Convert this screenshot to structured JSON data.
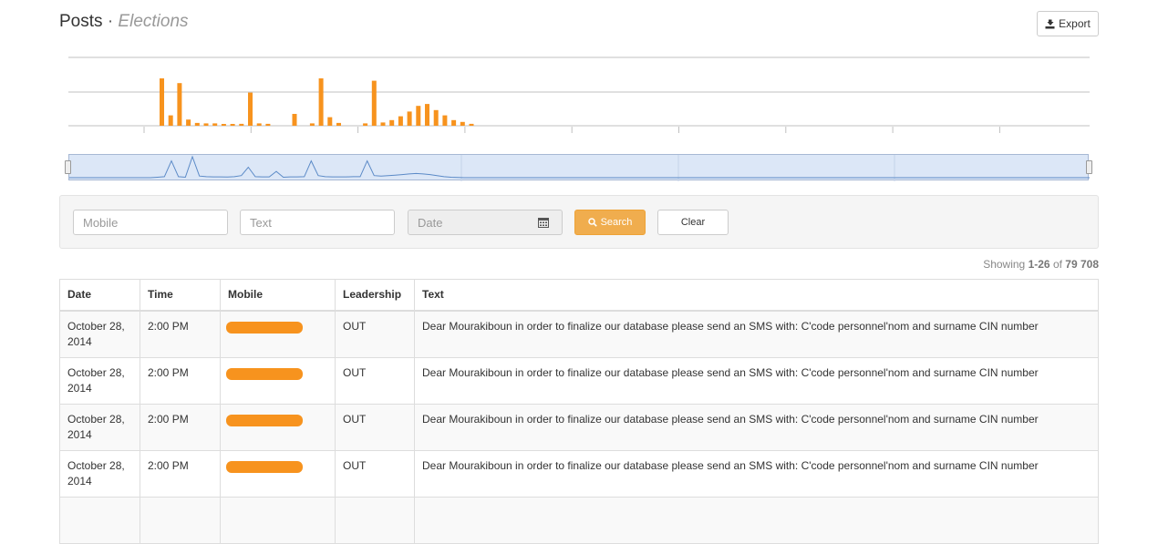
{
  "header": {
    "title": "Posts",
    "separator": "·",
    "subtitle": "Elections",
    "export_label": "Export"
  },
  "colors": {
    "bar": "#f7931e",
    "search_button": "#f0ad4e",
    "navigator_fill": "#dce7f7",
    "navigator_line": "#5b8ac7"
  },
  "chart_data": {
    "type": "bar",
    "series": [
      {
        "values": [
          1.0,
          0.22,
          0.9,
          0.13,
          0.06,
          0.05,
          0.05,
          0.02,
          0.02,
          0.04,
          0.7,
          0.05,
          0.04,
          0.0,
          0.0,
          0.25,
          0.0,
          0.05,
          1.0,
          0.18,
          0.06,
          0.0,
          0.0,
          0.05,
          0.95,
          0.07,
          0.12,
          0.2,
          0.3,
          0.42,
          0.46,
          0.33,
          0.22,
          0.12,
          0.08,
          0.04
        ]
      }
    ],
    "grid": true
  },
  "navigator": {
    "series": [
      0.0,
      0.0,
      0.0,
      0.0,
      0.0,
      0.0,
      0.0,
      0.0,
      0.0,
      0.0,
      0.02,
      0.05,
      0.8,
      0.05,
      0.02,
      1.0,
      0.08,
      0.05,
      0.04,
      0.04,
      0.03,
      0.05,
      0.1,
      0.5,
      0.05,
      0.04,
      0.04,
      0.3,
      0.02,
      0.04,
      0.04,
      0.05,
      0.8,
      0.1,
      0.05,
      0.04,
      0.04,
      0.04,
      0.05,
      0.05,
      0.8,
      0.1,
      0.08,
      0.1,
      0.12,
      0.15,
      0.18,
      0.2,
      0.18,
      0.15,
      0.1,
      0.05,
      0.02,
      0.01,
      0.0,
      0.0,
      0.0,
      0.0,
      0.0,
      0.0,
      0.0
    ]
  },
  "filters": {
    "mobile_placeholder": "Mobile",
    "text_placeholder": "Text",
    "date_placeholder": "Date",
    "calendar_icon": "calendar-icon",
    "search_icon": "search-icon",
    "search_label": "Search",
    "clear_label": "Clear"
  },
  "results": {
    "prefix": "Showing",
    "range": "1-26",
    "of": "of",
    "total": "79 708"
  },
  "table": {
    "headers": {
      "date": "Date",
      "time": "Time",
      "mobile": "Mobile",
      "leadership": "Leadership",
      "text": "Text"
    },
    "rows": [
      {
        "date": "October 28, 2014",
        "time": "2:00 PM",
        "leadership": "OUT",
        "text": "Dear Mourakiboun in order to finalize our database please send an SMS with: C'code personnel'nom and surname CIN number"
      },
      {
        "date": "October 28, 2014",
        "time": "2:00 PM",
        "leadership": "OUT",
        "text": "Dear Mourakiboun in order to finalize our database please send an SMS with: C'code personnel'nom and surname CIN number"
      },
      {
        "date": "October 28, 2014",
        "time": "2:00 PM",
        "leadership": "OUT",
        "text": "Dear Mourakiboun in order to finalize our database please send an SMS with: C'code personnel'nom and surname CIN number"
      },
      {
        "date": "October 28, 2014",
        "time": "2:00 PM",
        "leadership": "OUT",
        "text": "Dear Mourakiboun in order to finalize our database please send an SMS with: C'code personnel'nom and surname CIN number"
      },
      {
        "date": "",
        "time": "",
        "leadership": "",
        "text": ""
      }
    ]
  }
}
